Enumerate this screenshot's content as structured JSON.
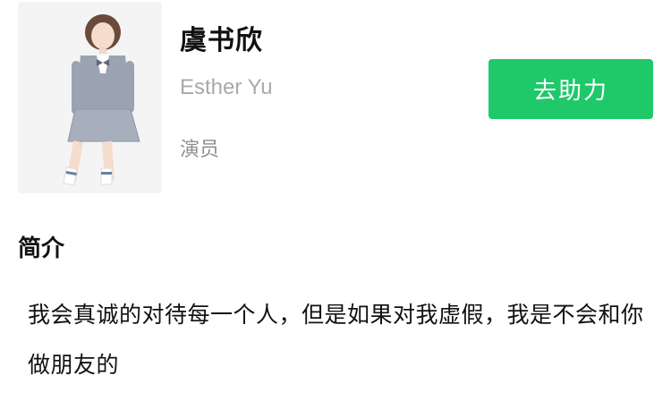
{
  "profile": {
    "name_zh": "虞书欣",
    "name_en": "Esther Yu",
    "occupation": "演员",
    "avatar_alt": "虞书欣"
  },
  "actions": {
    "support_label": "去助力",
    "support_color": "#1fc96a"
  },
  "intro": {
    "title": "简介",
    "text": "我会真诚的对待每一个人，但是如果对我虚假，我是不会和你做朋友的"
  }
}
